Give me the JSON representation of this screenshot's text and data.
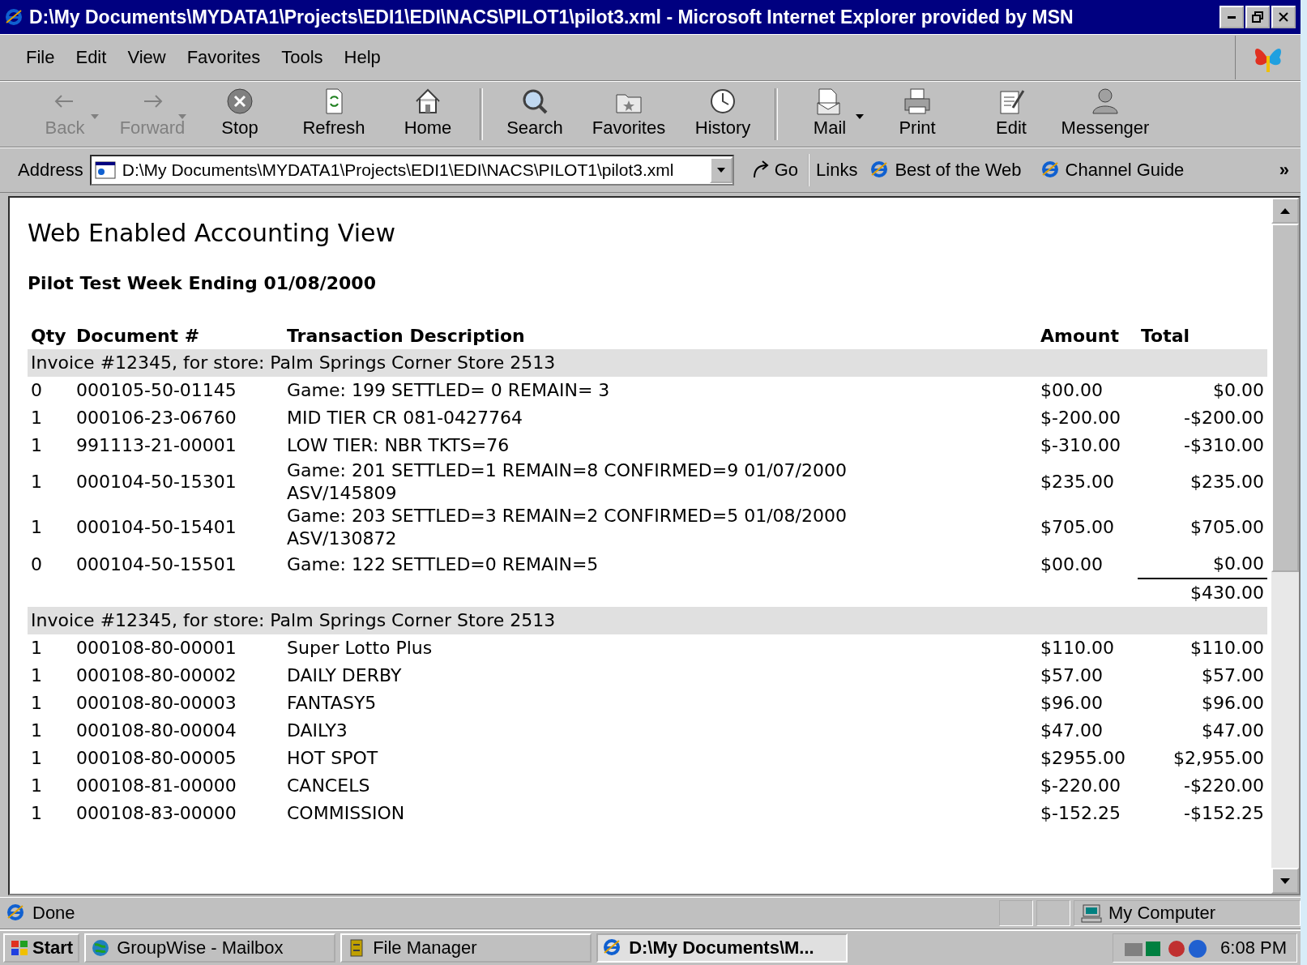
{
  "window": {
    "title": "D:\\My Documents\\MYDATA1\\Projects\\EDI1\\EDI\\NACS\\PILOT1\\pilot3.xml - Microsoft Internet Explorer provided by MSN"
  },
  "menu": [
    "File",
    "Edit",
    "View",
    "Favorites",
    "Tools",
    "Help"
  ],
  "toolbar": [
    [
      {
        "kind": "back",
        "label": "Back",
        "disabled": true,
        "menu": true
      },
      {
        "kind": "forward",
        "label": "Forward",
        "disabled": true,
        "menu": true
      },
      {
        "kind": "stop",
        "label": "Stop",
        "disabled": false,
        "menu": false
      },
      {
        "kind": "refresh",
        "label": "Refresh",
        "disabled": false,
        "menu": false
      },
      {
        "kind": "home",
        "label": "Home",
        "disabled": false,
        "menu": false
      }
    ],
    [
      {
        "kind": "search",
        "label": "Search",
        "disabled": false,
        "menu": false
      },
      {
        "kind": "favorites",
        "label": "Favorites",
        "disabled": false,
        "menu": false
      },
      {
        "kind": "history",
        "label": "History",
        "disabled": false,
        "menu": false
      }
    ],
    [
      {
        "kind": "mail",
        "label": "Mail",
        "disabled": false,
        "menu": true
      },
      {
        "kind": "print",
        "label": "Print",
        "disabled": false,
        "menu": false
      },
      {
        "kind": "edit",
        "label": "Edit",
        "disabled": false,
        "menu": false
      },
      {
        "kind": "messenger",
        "label": "Messenger",
        "disabled": false,
        "menu": false
      }
    ]
  ],
  "address_bar": {
    "label": "Address",
    "value": "D:\\My Documents\\MYDATA1\\Projects\\EDI1\\EDI\\NACS\\PILOT1\\pilot3.xml",
    "go": "Go",
    "links_label": "Links",
    "links": [
      "Best of the Web",
      "Channel Guide"
    ],
    "more": "»"
  },
  "page": {
    "heading": "Web Enabled Accounting View",
    "subheading": "Pilot Test Week Ending 01/08/2000",
    "columns": [
      "Qty",
      "Document #",
      "Transaction Description",
      "Amount",
      "Total"
    ],
    "invoices": [
      {
        "header": "Invoice #12345, for store: Palm Springs Corner Store 2513",
        "rows": [
          [
            "0",
            "000105-50-01145",
            "Game: 199 SETTLED= 0 REMAIN= 3",
            "$00.00",
            "$0.00"
          ],
          [
            "1",
            "000106-23-06760",
            "MID TIER CR 081-0427764",
            "$-200.00",
            "-$200.00"
          ],
          [
            "1",
            "991113-21-00001",
            "LOW TIER: NBR TKTS=76",
            "$-310.00",
            "-$310.00"
          ],
          [
            "1",
            "000104-50-15301",
            "Game: 201 SETTLED=1 REMAIN=8 CONFIRMED=9 01/07/2000 ASV/145809",
            "$235.00",
            "$235.00"
          ],
          [
            "1",
            "000104-50-15401",
            "Game: 203 SETTLED=3 REMAIN=2 CONFIRMED=5 01/08/2000 ASV/130872",
            "$705.00",
            "$705.00"
          ],
          [
            "0",
            "000104-50-15501",
            "Game: 122 SETTLED=0 REMAIN=5",
            "$00.00",
            "$0.00"
          ]
        ],
        "subtotal": "$430.00"
      },
      {
        "header": "Invoice #12345, for store: Palm Springs Corner Store 2513",
        "rows": [
          [
            "1",
            "000108-80-00001",
            "Super Lotto Plus",
            "$110.00",
            "$110.00"
          ],
          [
            "1",
            "000108-80-00002",
            "DAILY DERBY",
            "$57.00",
            "$57.00"
          ],
          [
            "1",
            "000108-80-00003",
            "FANTASY5",
            "$96.00",
            "$96.00"
          ],
          [
            "1",
            "000108-80-00004",
            "DAILY3",
            "$47.00",
            "$47.00"
          ],
          [
            "1",
            "000108-80-00005",
            "HOT SPOT",
            "$2955.00",
            "$2,955.00"
          ],
          [
            "1",
            "000108-81-00000",
            "CANCELS",
            "$-220.00",
            "-$220.00"
          ],
          [
            "1",
            "000108-83-00000",
            "COMMISSION",
            "$-152.25",
            "-$152.25"
          ]
        ]
      }
    ]
  },
  "status_bar": {
    "text": "Done",
    "zone": "My Computer"
  },
  "taskbar": {
    "start": "Start",
    "tasks": [
      {
        "label": "GroupWise - Mailbox",
        "selected": false
      },
      {
        "label": "File Manager",
        "selected": false
      },
      {
        "label": "D:\\My Documents\\M...",
        "selected": true
      }
    ],
    "clock": "6:08 PM"
  }
}
